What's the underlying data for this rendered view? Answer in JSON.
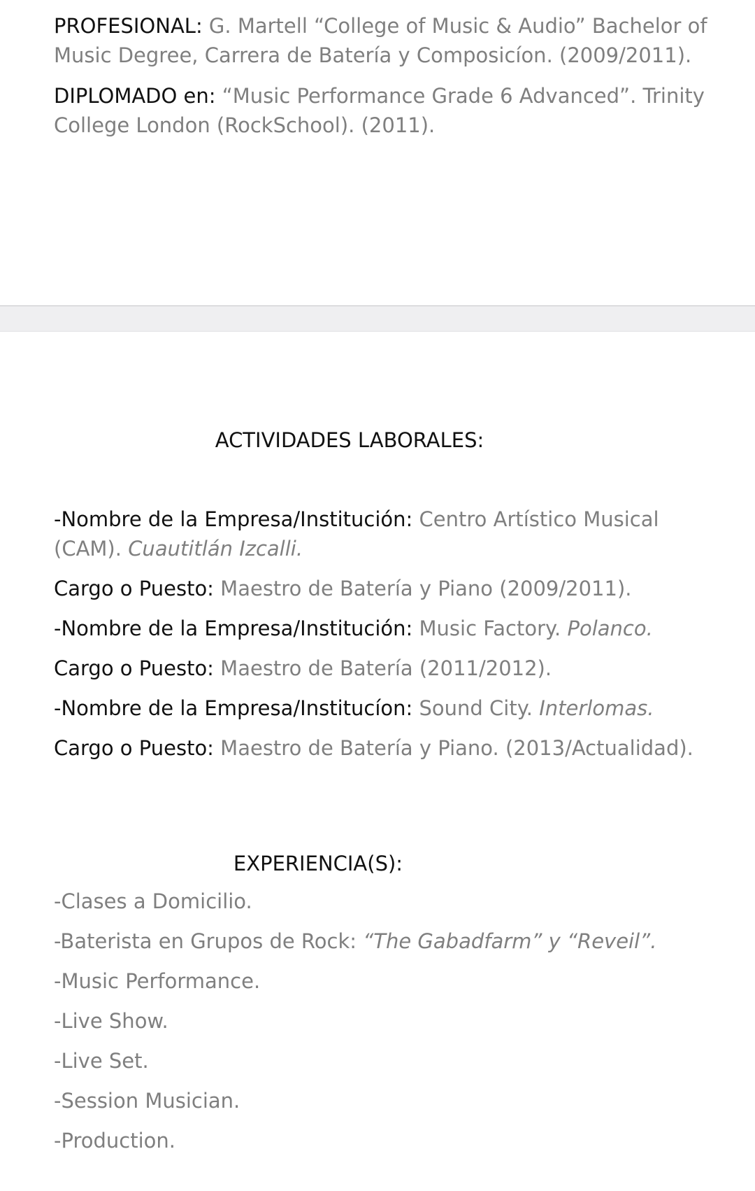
{
  "education": [
    {
      "label": "PROFESIONAL:",
      "value": " G. Martell “College of Music & Audio” Bachelor of Music Degree, Carrera de Batería y Composicíon. (2009/2011)."
    },
    {
      "label": "DIPLOMADO en:",
      "value": " “Music Performance Grade 6 Advanced”. Trinity College London (RockSchool). (2011)."
    }
  ],
  "work": {
    "heading": "ACTIVIDADES LABORALES:",
    "entries": [
      {
        "company_label": "-Nombre de la Empresa/Institución:",
        "company": " Centro Artístico Musical (CAM). ",
        "location": "Cuautitlán Izcalli.",
        "position_label": "Cargo o Puesto:",
        "position": " Maestro de Batería y Piano (2009/2011)."
      },
      {
        "company_label": "-Nombre de la Empresa/Institución:",
        "company": " Music Factory. ",
        "location": "Polanco.",
        "position_label": "Cargo o Puesto:",
        "position": " Maestro de Batería (2011/2012)."
      },
      {
        "company_label": "-Nombre de la Empresa/Institucíon:",
        "company": " Sound City. ",
        "location": "Interlomas.",
        "position_label": "Cargo o Puesto:",
        "position": " Maestro de Batería y Piano. (2013/Actualidad)."
      }
    ]
  },
  "experience": {
    "heading": "EXPERIENCIA(S):",
    "items": [
      "-Clases a Domicilio.",
      "-Music Performance.",
      "-Live Show.",
      "-Live Set.",
      "-Session Musician.",
      "-Production."
    ],
    "bands": {
      "prefix": "-Baterista en Grupos de Rock: ",
      "names": "“The Gabadfarm” y “Reveil”."
    }
  }
}
